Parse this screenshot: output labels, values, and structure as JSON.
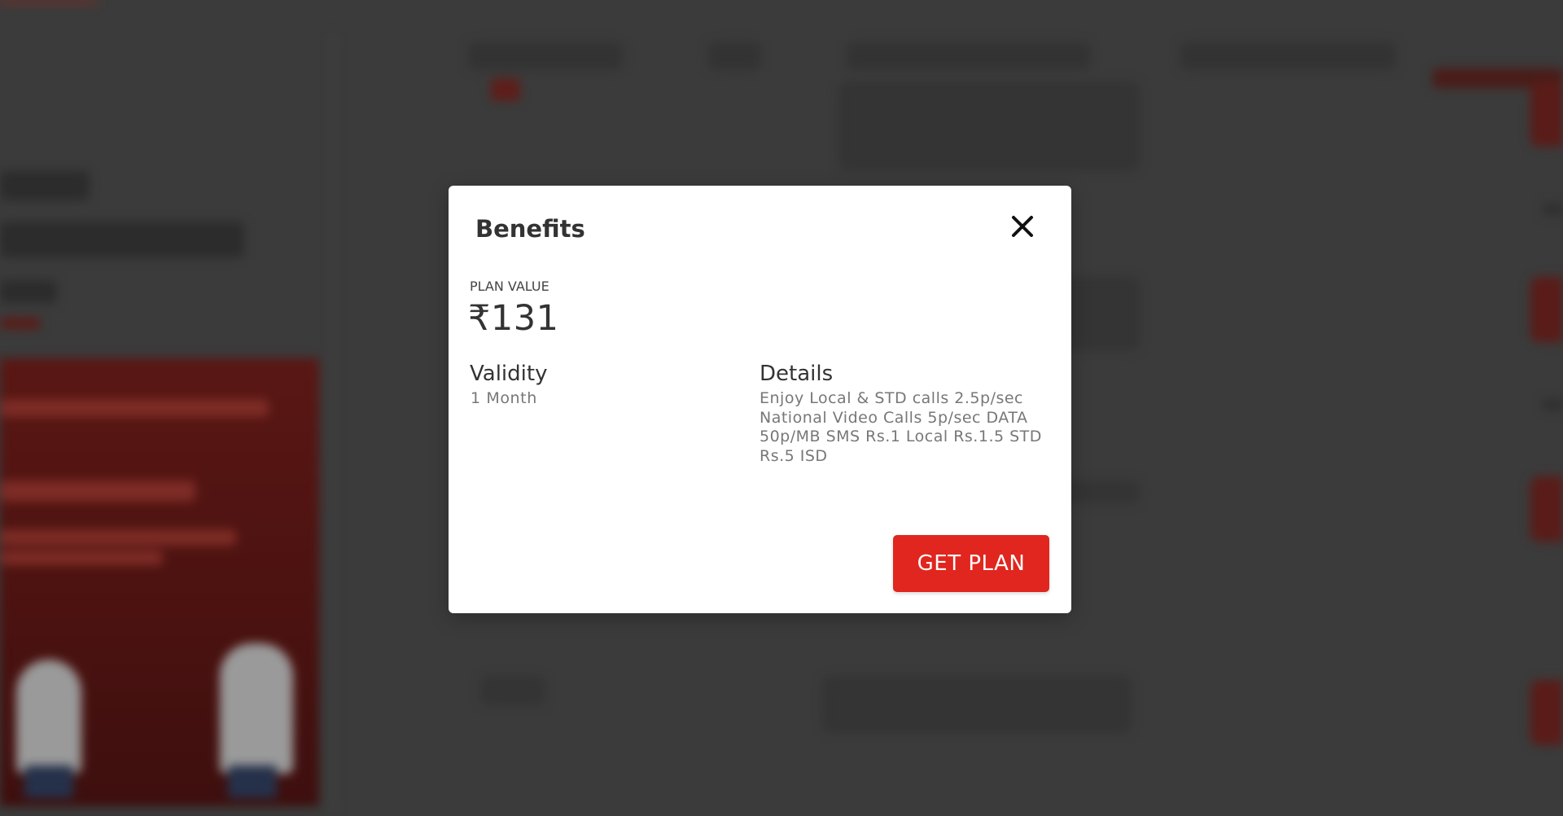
{
  "modal": {
    "title": "Benefits",
    "plan_value_label": "PLAN VALUE",
    "plan_value_amount": "₹131",
    "validity_label": "Validity",
    "validity_value": "1 Month",
    "details_label": "Details",
    "details_text": "Enjoy Local & STD calls 2.5p/sec National Video Calls 5p/sec DATA 50p/MB SMS Rs.1 Local Rs.1.5 STD Rs.5 ISD",
    "get_plan_label": "GET PLAN",
    "close_icon": "close-icon"
  },
  "colors": {
    "accent": "#e0261e",
    "overlay": "#3b3b3b",
    "title_text": "#333333",
    "muted_text": "#777777"
  }
}
